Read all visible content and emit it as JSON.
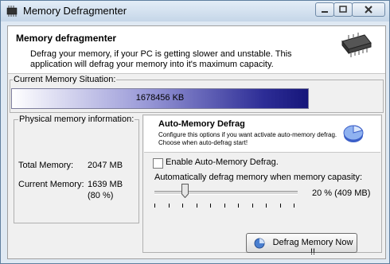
{
  "window": {
    "title": "Memory Defragmenter",
    "icon": "chip-icon"
  },
  "header": {
    "title": "Memory defragmenter",
    "description": "Defrag your memory, if your PC is getting slower and unstable. This application will defrag your memory into it's maximum capacity.",
    "icon": "memory-chip-icon"
  },
  "current_memory": {
    "label": "Current Memory Situation:",
    "value_text": "1678456 KB",
    "fill_fraction": 0.8
  },
  "physical_memory": {
    "label": "Physical memory information:",
    "total_label": "Total Memory:",
    "total_value": "2047 MB",
    "current_label": "Current Memory:",
    "current_value": "1639 MB",
    "current_percent": "(80 %)"
  },
  "auto_defrag": {
    "title": "Auto-Memory Defrag",
    "description": "Configure this options if you want activate auto-memory defrag. Choose when auto-defrag start!",
    "icon": "pie-chart-icon",
    "enable_label": "Enable Auto-Memory Defrag.",
    "enabled": false,
    "slider_label": "Automatically defrag memory when memory capasity:",
    "slider_value_text": "20 % (409 MB)",
    "slider_percent": 20
  },
  "buttons": {
    "defrag_now": "Defrag Memory Now !!"
  },
  "colors": {
    "memory_bar_dark": "#16167a",
    "memory_bar_mid": "#9a9ad8",
    "title_bar": "#c5d6e8"
  }
}
